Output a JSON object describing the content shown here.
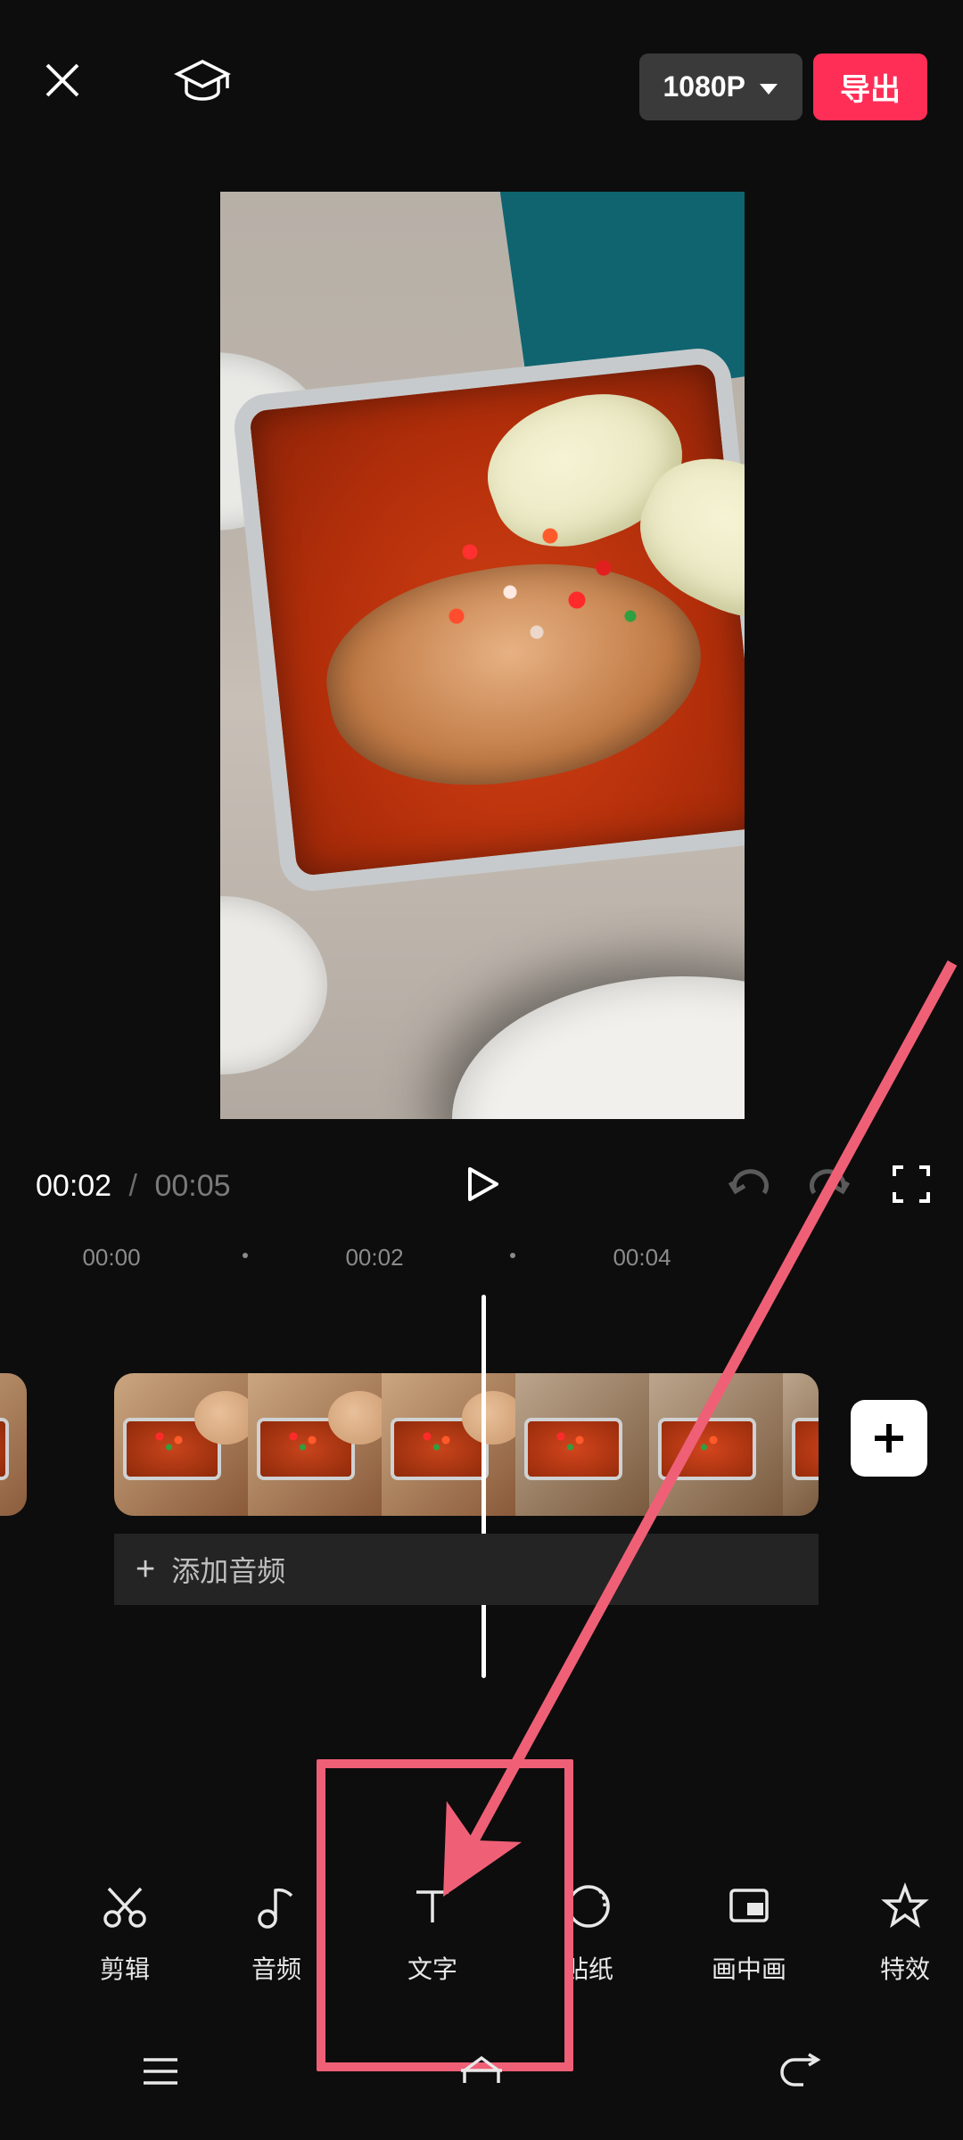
{
  "header": {
    "resolution_label": "1080P",
    "export_label": "导出"
  },
  "playback": {
    "current_time": "00:02",
    "separator": "/",
    "duration": "00:05"
  },
  "ruler": {
    "ticks": [
      "00:00",
      "00:02",
      "00:04"
    ]
  },
  "audio": {
    "add_audio_label": "添加音频"
  },
  "toolbar": {
    "items": [
      {
        "id": "edit",
        "label": "剪辑"
      },
      {
        "id": "audio",
        "label": "音频"
      },
      {
        "id": "text",
        "label": "文字"
      },
      {
        "id": "sticker",
        "label": "贴纸"
      },
      {
        "id": "pip",
        "label": "画中画"
      },
      {
        "id": "fx",
        "label": "特效"
      }
    ]
  },
  "annotation": {
    "highlight_target": "toolbar.text",
    "color": "#ef6076"
  }
}
